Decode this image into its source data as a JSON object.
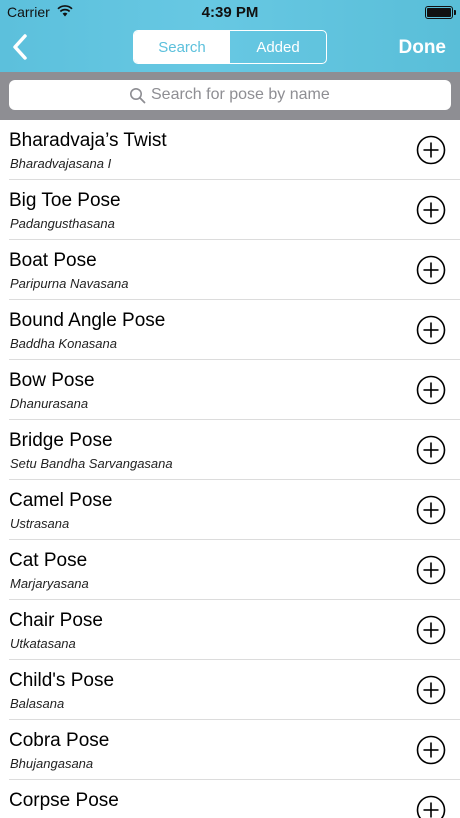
{
  "status_bar": {
    "carrier": "Carrier",
    "time": "4:39 PM"
  },
  "nav": {
    "segments": [
      {
        "label": "Search",
        "selected": true
      },
      {
        "label": "Added",
        "selected": false
      }
    ],
    "done_label": "Done"
  },
  "search": {
    "placeholder": "Search for pose by name",
    "value": ""
  },
  "poses": [
    {
      "name": "Bharadvaja’s Twist",
      "sanskrit": "Bharadvajasana I"
    },
    {
      "name": "Big Toe Pose",
      "sanskrit": "Padangusthasana"
    },
    {
      "name": "Boat Pose",
      "sanskrit": "Paripurna Navasana"
    },
    {
      "name": "Bound Angle Pose",
      "sanskrit": "Baddha Konasana"
    },
    {
      "name": "Bow Pose",
      "sanskrit": "Dhanurasana"
    },
    {
      "name": "Bridge Pose",
      "sanskrit": "Setu Bandha Sarvangasana"
    },
    {
      "name": "Camel Pose",
      "sanskrit": "Ustrasana"
    },
    {
      "name": "Cat Pose",
      "sanskrit": "Marjaryasana"
    },
    {
      "name": "Chair Pose",
      "sanskrit": "Utkatasana"
    },
    {
      "name": "Child's Pose",
      "sanskrit": "Balasana"
    },
    {
      "name": "Cobra Pose",
      "sanskrit": "Bhujangasana"
    },
    {
      "name": "Corpse Pose",
      "sanskrit": ""
    }
  ],
  "colors": {
    "header": "#5cc0dc",
    "search_bar_bg": "#8e8e93",
    "separator": "#dcdcdc"
  },
  "icons": {
    "back": "chevron-left-icon",
    "add": "plus-circle-icon",
    "search": "magnifier-icon",
    "wifi": "wifi-icon",
    "battery": "battery-icon"
  }
}
